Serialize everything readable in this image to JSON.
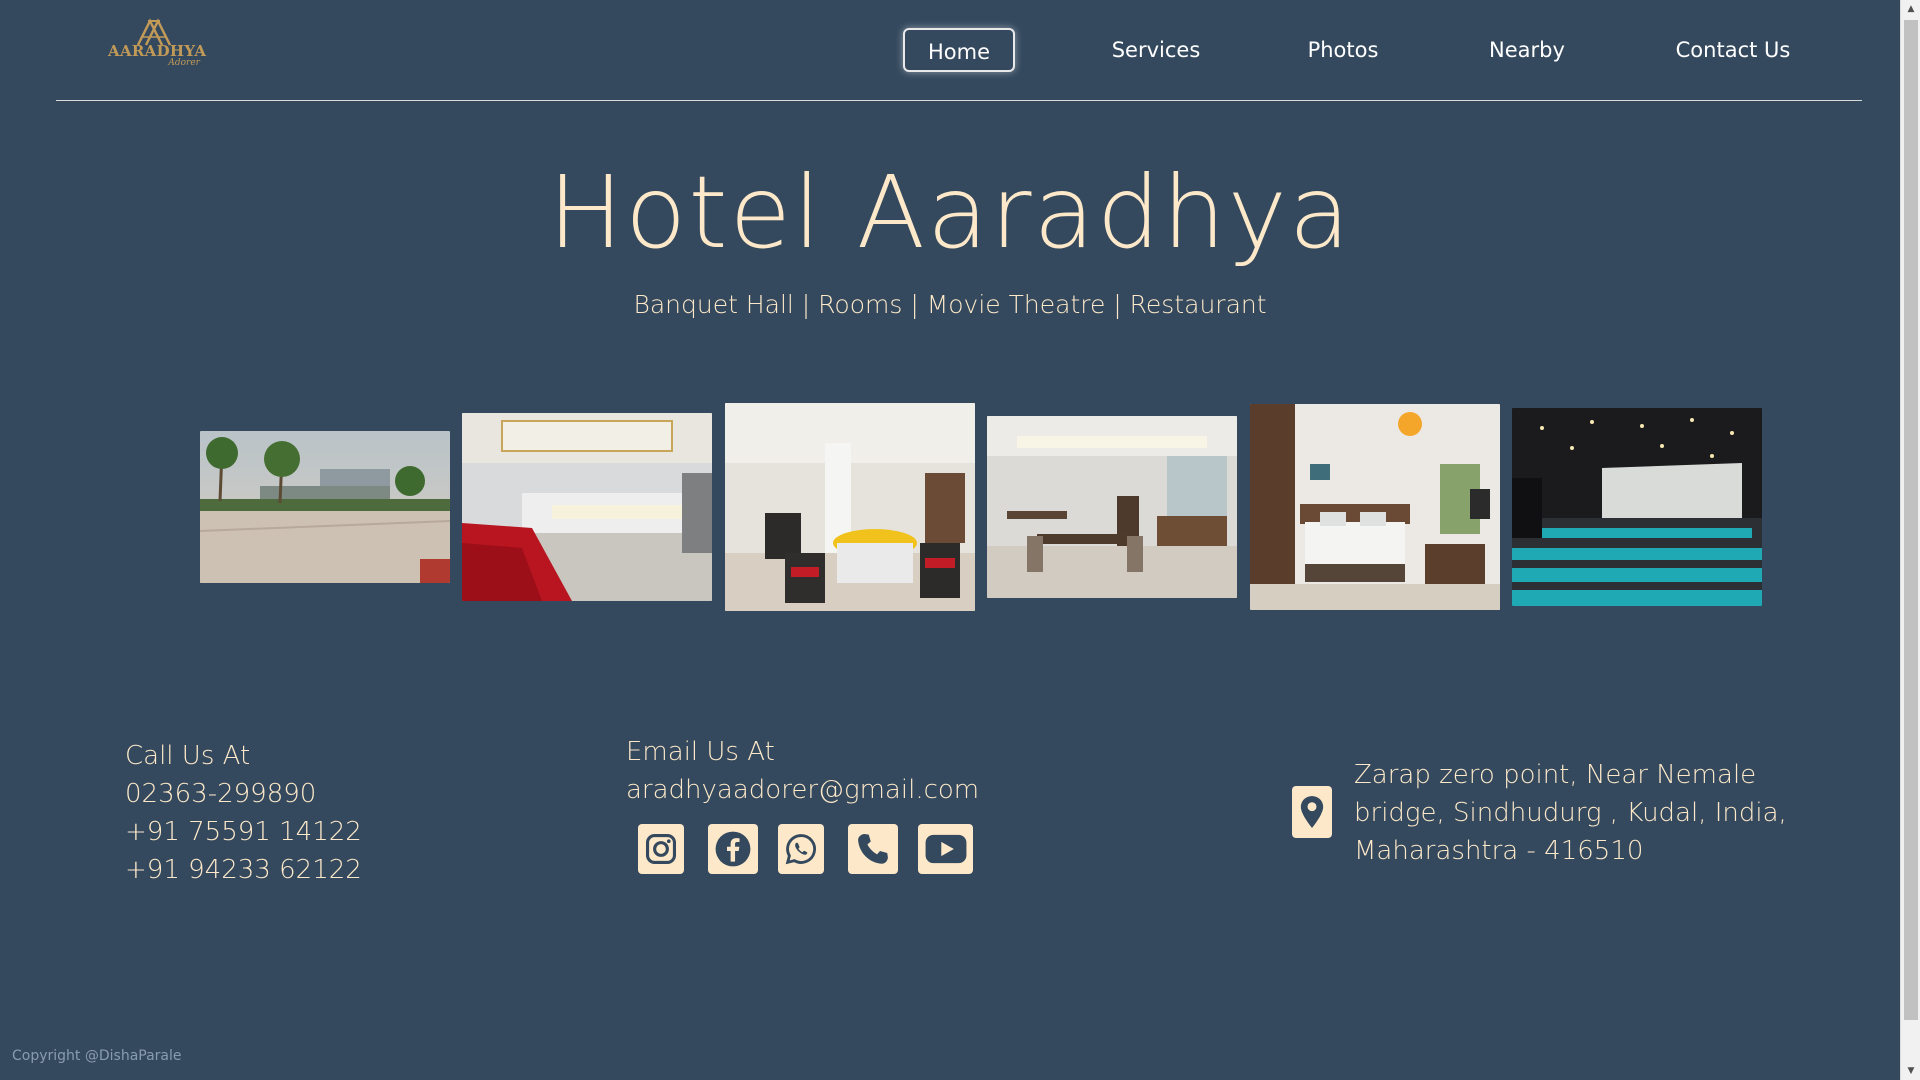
{
  "brand": {
    "logo_word": "AARADHYA",
    "logo_sub": "Adorer"
  },
  "nav": [
    {
      "label": "Home",
      "active": true
    },
    {
      "label": "Services",
      "active": false
    },
    {
      "label": "Photos",
      "active": false
    },
    {
      "label": "Nearby",
      "active": false
    },
    {
      "label": "Contact Us",
      "active": false
    }
  ],
  "hero": {
    "title": "Hotel Aaradhya",
    "subtitle": "Banquet Hall | Rooms | Movie Theatre | Restaurant"
  },
  "gallery": [
    {
      "name": "hotel-exterior-photo",
      "subject": "hotel exterior with palm trees"
    },
    {
      "name": "banquet-hall-photo",
      "subject": "banquet hall with red stage"
    },
    {
      "name": "restaurant-round-tables-photo",
      "subject": "restaurant with round yellow tables"
    },
    {
      "name": "dining-room-photo",
      "subject": "dining room with wooden tables"
    },
    {
      "name": "hotel-room-photo",
      "subject": "hotel bedroom"
    },
    {
      "name": "movie-theatre-photo",
      "subject": "movie theatre with teal seats"
    }
  ],
  "contact": {
    "call_title": "Call Us At",
    "phones": [
      "02363-299890",
      "+91 75591 14122",
      "+91 94233 62122"
    ],
    "email_title": "Email Us At",
    "email": "aradhyaadorer@gmail.com",
    "social_icons": [
      "instagram-icon",
      "facebook-icon",
      "whatsapp-icon",
      "phone-icon",
      "youtube-icon"
    ],
    "address_lines": [
      "Zarap zero point, Near Nemale",
      "bridge, Sindhudurg , Kudal, India,",
      "Maharashtra - 416510"
    ]
  },
  "footer": {
    "copyright": "Copyright @DishaParale"
  },
  "colors": {
    "background": "#34495e",
    "cream": "#fde9c9",
    "logo_gold": "#c29a58"
  }
}
